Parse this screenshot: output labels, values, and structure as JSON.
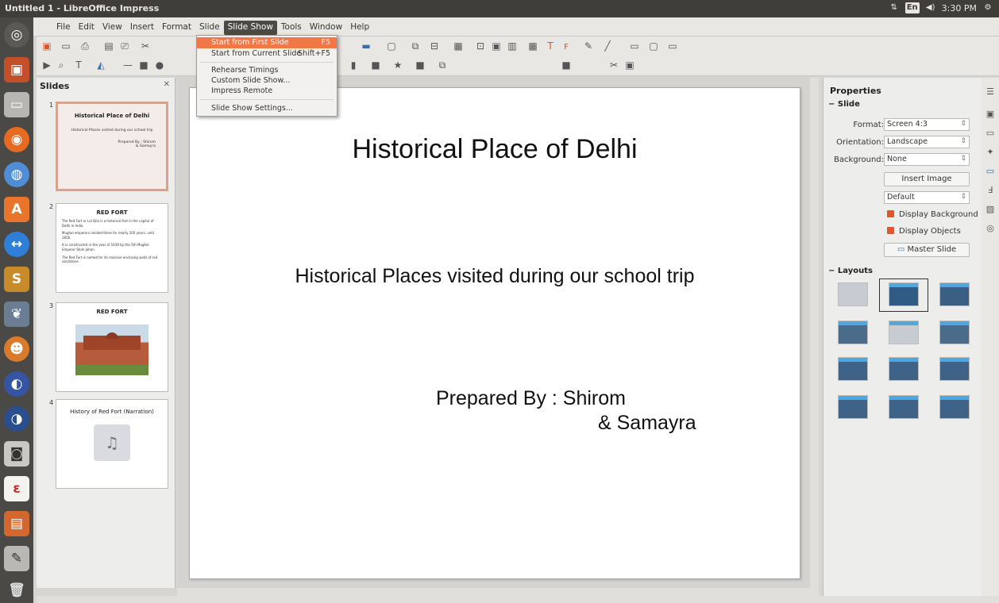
{
  "window": {
    "title": "Untitled 1 - LibreOffice Impress"
  },
  "tray": {
    "network": "⇅",
    "lang": "En",
    "volume": "◀)",
    "clock": "3:30 PM",
    "settings": "⚙"
  },
  "menubar": {
    "items": [
      "File",
      "Edit",
      "View",
      "Insert",
      "Format",
      "Slide",
      "Slide Show",
      "Tools",
      "Window",
      "Help"
    ],
    "active": "Slide Show"
  },
  "slideshow_menu": {
    "items": [
      {
        "label": "Start from First Slide",
        "shortcut": "F5"
      },
      {
        "label": "Start from Current Slide",
        "shortcut": "Shift+F5"
      },
      {
        "label": "Rehearse Timings",
        "shortcut": ""
      },
      {
        "label": "Custom Slide Show...",
        "shortcut": ""
      },
      {
        "label": "Impress Remote",
        "shortcut": ""
      },
      {
        "label": "Slide Show Settings...",
        "shortcut": ""
      }
    ]
  },
  "slides_pane": {
    "title": "Slides",
    "slides": [
      {
        "num": "1",
        "title": "Historical Place of Delhi",
        "subtitle": "Historical Places visited during our school trip",
        "prepared": "Prepared By : Shirom",
        "prepared2": "& Samayra"
      },
      {
        "num": "2",
        "title": "RED FORT",
        "bullets": [
          "The Red Fort or Lal Qila is a historical fort in the capital of Delhi in India.",
          "Mughal emperors resided there for nearly 200 years, until 1856.",
          "It is constructed in the year of 1639 by the 5th Mughal Emperor Shah Jahan.",
          "The Red Fort is named for its massive enclosing walls of red sandstone."
        ]
      },
      {
        "num": "3",
        "title": "RED FORT"
      },
      {
        "num": "4",
        "title": "History of Red Fort (Narration)"
      }
    ]
  },
  "slide": {
    "title": "Historical Place of Delhi",
    "subtitle": "Historical Places visited during our school trip",
    "prepared_line1": "Prepared By : Shirom",
    "prepared_line2": "& Samayra"
  },
  "properties": {
    "title": "Properties",
    "slide_section": "Slide",
    "format_label": "Format:",
    "format_value": "Screen 4:3",
    "orientation_label": "Orientation:",
    "orientation_value": "Landscape",
    "background_label": "Background:",
    "background_value": "None",
    "insert_image": "Insert Image",
    "master_value": "Default",
    "display_background": "Display Background",
    "display_objects": "Display Objects",
    "master_slide": "Master Slide",
    "layouts_section": "Layouts"
  },
  "colors": {
    "accent": "#f07746",
    "launcher": "#4a4946",
    "topbar": "#3f3e39"
  }
}
